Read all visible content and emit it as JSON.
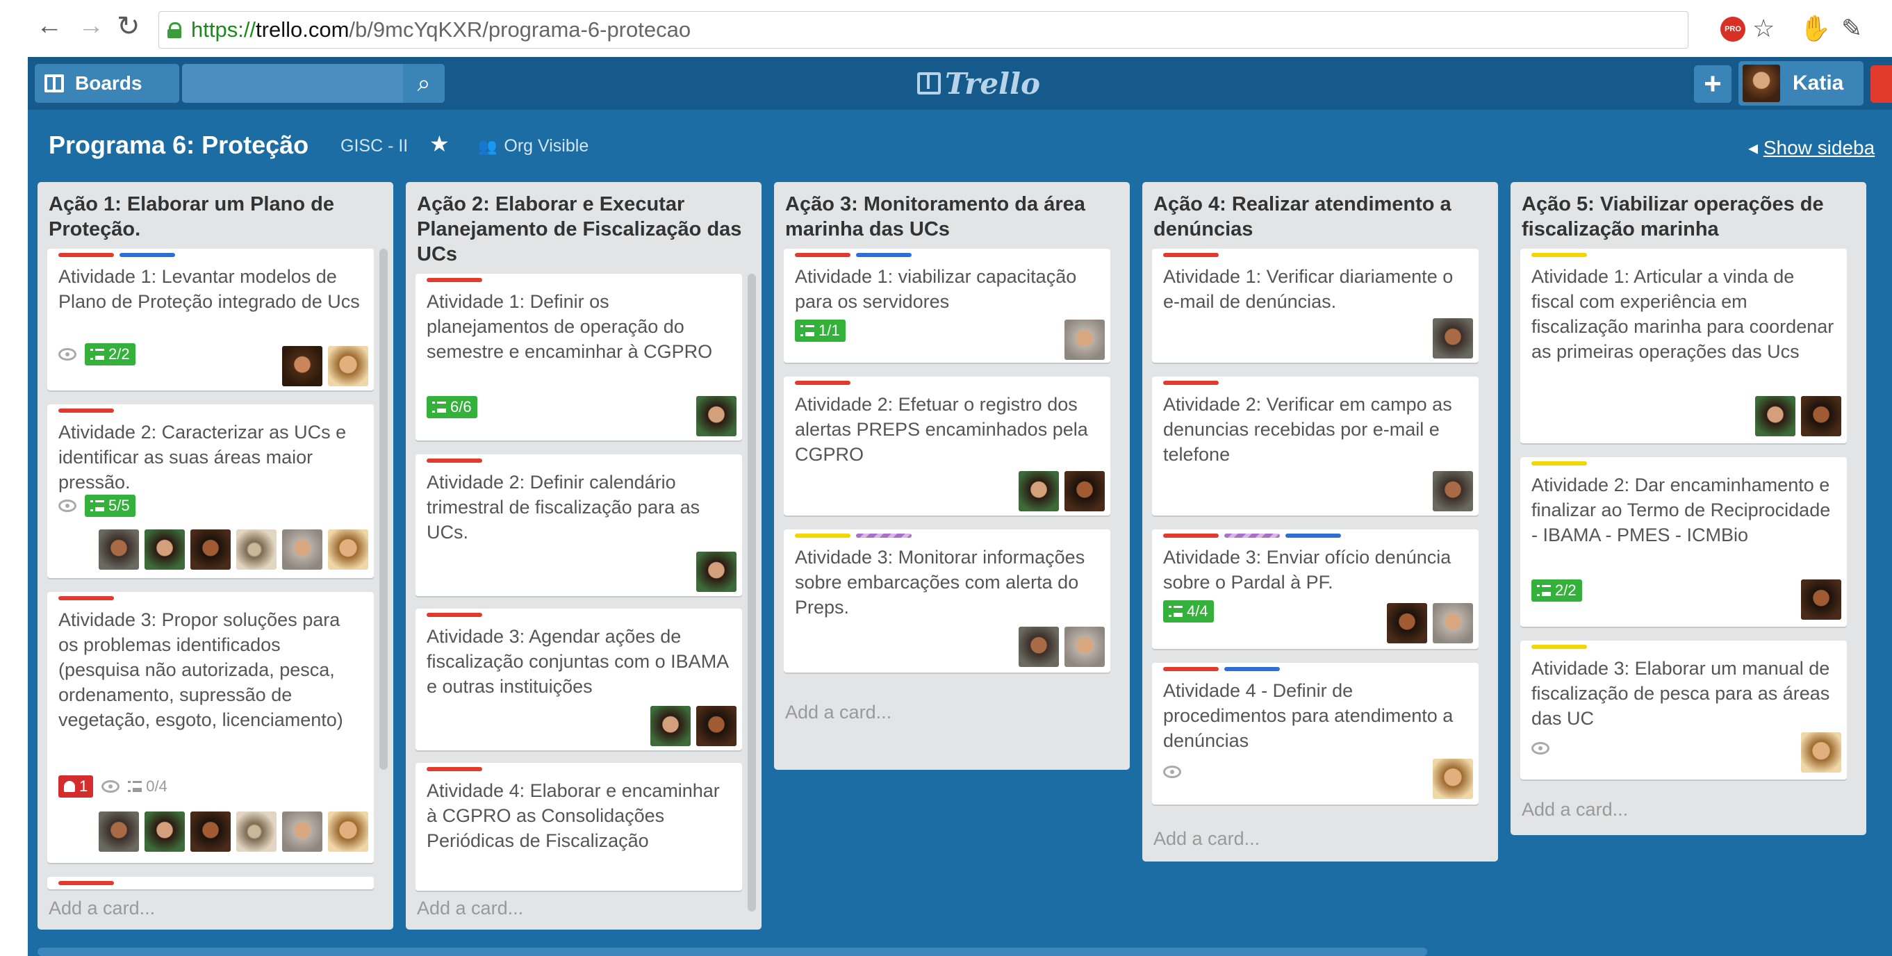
{
  "browser": {
    "back_icon": "arrow-left-icon",
    "forward_icon": "arrow-right-icon",
    "reload_icon": "reload-icon",
    "url_scheme": "https://",
    "url_host": "trello.com",
    "url_path": "/b/9mcYqKXR/programa-6-protecao",
    "pro_badge": "PRO"
  },
  "header": {
    "boards_label": "Boards",
    "logo_text": "Trello",
    "add_label": "+",
    "user_name": "Katia"
  },
  "board": {
    "title": "Programa 6: Proteção",
    "org": "GISC - II",
    "visibility": "Org Visible",
    "show_sidebar": "Show sideba"
  },
  "colors": {
    "board_bg": "#1c6da3",
    "header_bg": "#155a8a",
    "label_red": "#e23b2e",
    "label_blue": "#2e6fd4",
    "label_yellow": "#f2d600",
    "label_purple": "#a970c7",
    "checklist_green": "#34b13b"
  },
  "lists": [
    {
      "title": "Ação 1: Elaborar um Plano de Proteção.",
      "add_card": "Add a card...",
      "cards": [
        {
          "text": "Atividade 1: Levantar modelos de Plano de Proteção integrado de Ucs",
          "checklist": "2/2"
        },
        {
          "text": "Atividade 2: Caracterizar as UCs e identificar as suas áreas maior pressão.",
          "checklist": "5/5"
        },
        {
          "text": "Atividade 3: Propor soluções para os problemas identificados (pesquisa não autorizada, pesca, ordenamento, supressão de vegetação, esgoto, licenciamento)",
          "alert": "1",
          "checklist": "0/4"
        }
      ]
    },
    {
      "title": "Ação 2: Elaborar e Executar Planejamento de Fiscalização das UCs",
      "add_card": "Add a card...",
      "cards": [
        {
          "text": "Atividade 1: Definir os planejamentos de operação do semestre e encaminhar à CGPRO",
          "checklist": "6/6"
        },
        {
          "text": "Atividade 2: Definir calendário trimestral de fiscalização para as UCs."
        },
        {
          "text": "Atividade 3: Agendar ações de fiscalização conjuntas com o IBAMA e outras instituições"
        },
        {
          "text": "Atividade 4: Elaborar e encaminhar à CGPRO as Consolidações Periódicas de Fiscalização"
        }
      ]
    },
    {
      "title": "Ação 3: Monitoramento da área marinha das UCs",
      "add_card": "Add a card...",
      "cards": [
        {
          "text": "Atividade 1: viabilizar capacitação para os servidores",
          "checklist": "1/1"
        },
        {
          "text": "Atividade 2: Efetuar o registro dos alertas PREPS encaminhados pela CGPRO"
        },
        {
          "text": "Atividade 3: Monitorar informações sobre embarcações com alerta do Preps."
        }
      ]
    },
    {
      "title": "Ação 4: Realizar atendimento a denúncias",
      "add_card": "Add a card...",
      "cards": [
        {
          "text": "Atividade 1: Verificar diariamente o e-mail de denúncias."
        },
        {
          "text": "Atividade 2: Verificar em campo as denuncias recebidas por e-mail e telefone"
        },
        {
          "text": "Atividade 3: Enviar ofício denúncia sobre o Pardal à PF.",
          "checklist": "4/4"
        },
        {
          "text": "Atividade 4 - Definir de procedimentos para atendimento a denúncias"
        }
      ]
    },
    {
      "title": "Ação 5: Viabilizar operações de fiscalização marinha",
      "add_card": "Add a card...",
      "cards": [
        {
          "text": "Atividade 1: Articular a vinda de fiscal com experiência em fiscalização marinha para coordenar as primeiras operações das Ucs"
        },
        {
          "text": "Atividade 2: Dar encaminhamento e finalizar ao Termo de Reciprocidade - IBAMA - PMES - ICMBio",
          "checklist": "2/2"
        },
        {
          "text": "Atividade 3: Elaborar um manual de fiscalização de pesca para as áreas das UC"
        }
      ]
    }
  ]
}
